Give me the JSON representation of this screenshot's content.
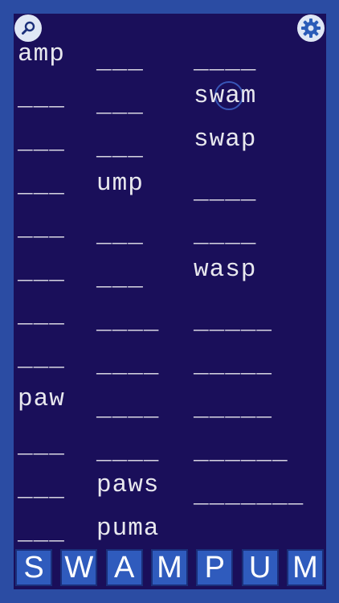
{
  "colors": {
    "frame": "#2b4ca3",
    "board": "#1a0f5a",
    "text": "#e8e8ee",
    "tile": "#2f5bbd"
  },
  "icons": {
    "search": "search-icon",
    "settings": "gear-icon"
  },
  "columns": [
    [
      "amp",
      "___",
      "___",
      "___",
      "___",
      "___",
      "___",
      "___",
      "paw",
      "___",
      "___",
      "___"
    ],
    [
      "___",
      "___",
      "___",
      "ump",
      "___",
      "___",
      "____",
      "____",
      "____",
      "____",
      "paws",
      "puma"
    ],
    [
      "____",
      "swam",
      "swap",
      "____",
      "____",
      "wasp",
      "_____",
      "_____",
      "_____",
      "______",
      "_______"
    ]
  ],
  "tiles": [
    "S",
    "W",
    "A",
    "M",
    "P",
    "U",
    "M"
  ]
}
